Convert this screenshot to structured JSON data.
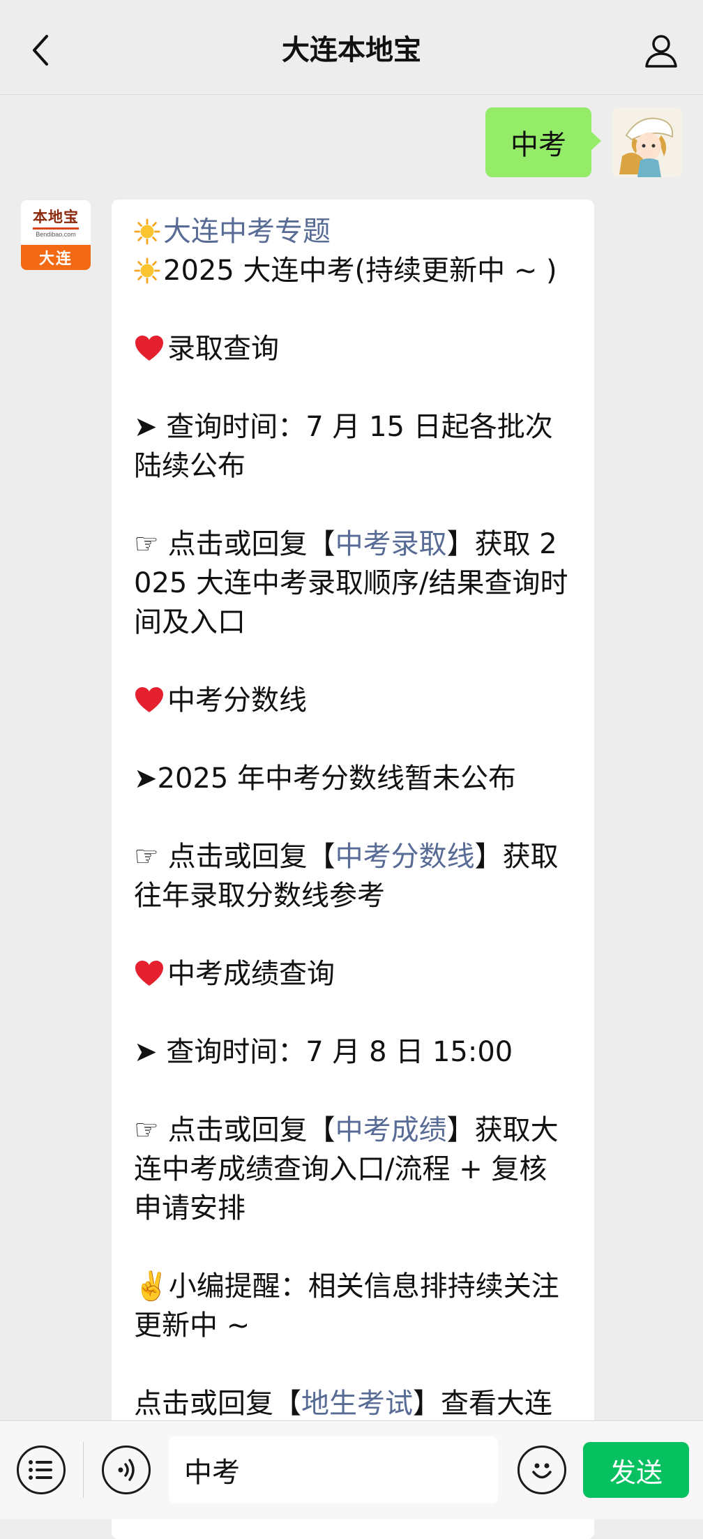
{
  "header": {
    "title": "大连本地宝"
  },
  "outgoing": {
    "text": "中考"
  },
  "bot": {
    "logo_cn": "本地宝",
    "logo_en": "Bendibao.com",
    "logo_city": "大连"
  },
  "message": {
    "topic_link": "大连中考专题",
    "line2": "2025 大连中考(持续更新中 ~ )",
    "sec1_title": "录取查询",
    "sec1_arrow": "➤ 查询时间：7 月 15 日起各批次陆续公布",
    "sec1_pre": "☞ 点击或回复【",
    "sec1_link": "中考录取",
    "sec1_post": "】获取 2025 大连中考录取顺序/结果查询时间及入口",
    "sec2_title": "中考分数线",
    "sec2_arrow": "➤2025 年中考分数线暂未公布",
    "sec2_pre": "☞ 点击或回复【",
    "sec2_link": "中考分数线",
    "sec2_post": "】获取往年录取分数线参考",
    "sec3_title": "中考成绩查询",
    "sec3_arrow": "➤ 查询时间：7 月 8 日 15:00",
    "sec3_pre": "☞ 点击或回复【",
    "sec3_link": "中考成绩",
    "sec3_post": "】获取大连中考成绩查询入口/流程 + 复核申请安排",
    "reminder": "✌️小编提醒：相关信息排持续关注更新中 ~",
    "last_pre": "点击或回复【",
    "last_link": "地生考试",
    "last_post": "】查看大连"
  },
  "input": {
    "value": "中考",
    "send_label": "发送"
  },
  "colors": {
    "bubble_out": "#95ec69",
    "link": "#576b95",
    "send": "#07c160",
    "bot_orange": "#f26a13"
  }
}
